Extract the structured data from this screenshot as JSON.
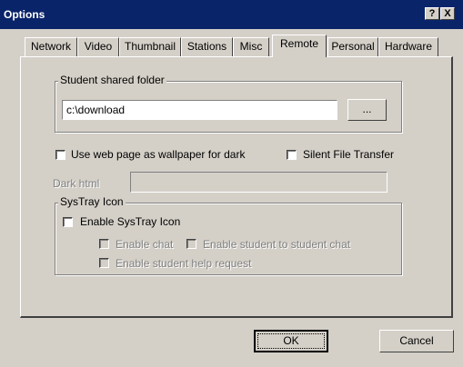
{
  "window": {
    "title": "Options",
    "help_button": "?",
    "close_button": "X"
  },
  "tabs": [
    {
      "label": "Network"
    },
    {
      "label": "Video"
    },
    {
      "label": "Thumbnail"
    },
    {
      "label": "Stations"
    },
    {
      "label": "Misc"
    },
    {
      "label": "Remote",
      "active": true
    },
    {
      "label": "Personal"
    },
    {
      "label": "Hardware"
    }
  ],
  "shared_folder": {
    "group_label": "Student shared folder",
    "path_value": "c:\\download",
    "browse_label": "..."
  },
  "options": {
    "wallpaper_label": "Use web page as wallpaper for dark",
    "wallpaper_checked": false,
    "silent_transfer_label": "Silent File Transfer",
    "silent_transfer_checked": false,
    "dark_html_label": "Dark html",
    "dark_html_value": ""
  },
  "systray": {
    "group_label": "SysTray Icon",
    "enable_label": "Enable SysTray Icon",
    "enable_checked": false,
    "enable_chat_label": "Enable chat",
    "enable_s2s_chat_label": "Enable student to student chat",
    "enable_help_label": "Enable student help request"
  },
  "footer": {
    "ok_label": "OK",
    "cancel_label": "Cancel"
  }
}
